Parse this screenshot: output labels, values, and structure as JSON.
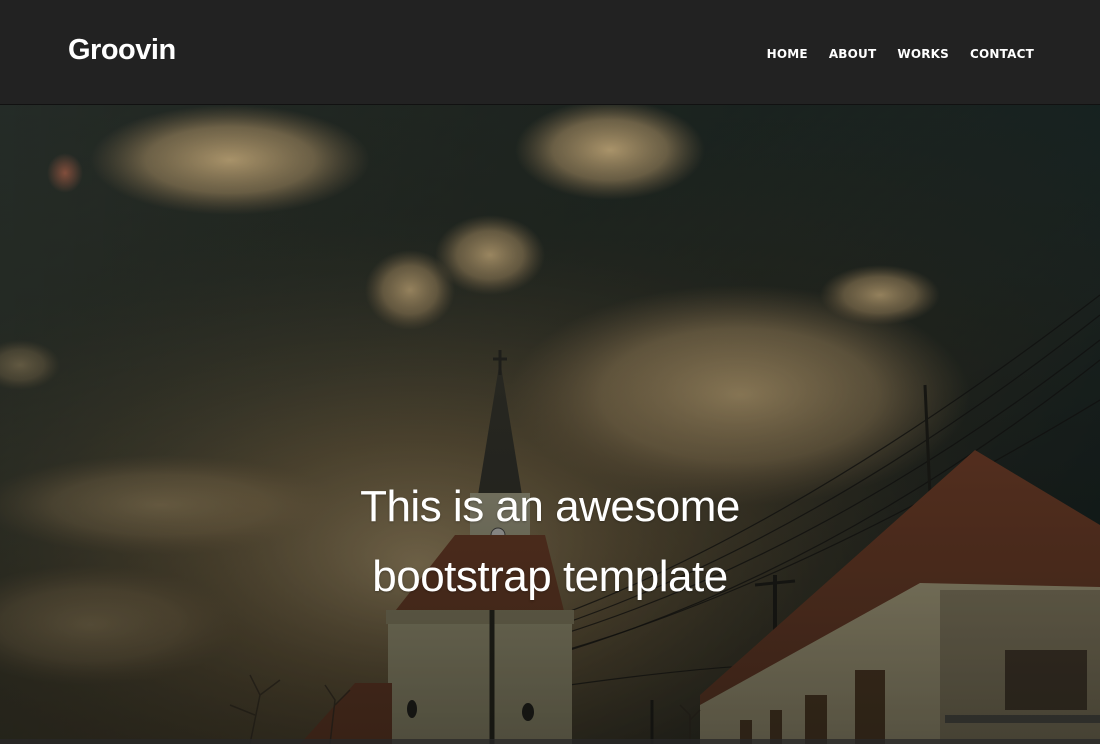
{
  "brand": "Groovin",
  "nav": {
    "items": [
      {
        "label": "HOME"
      },
      {
        "label": "ABOUT"
      },
      {
        "label": "WORKS"
      },
      {
        "label": "CONTACT"
      }
    ]
  },
  "hero": {
    "title": "This is an awesome bootstrap template"
  },
  "colors": {
    "navbar_bg": "#222222",
    "text": "#ffffff"
  }
}
